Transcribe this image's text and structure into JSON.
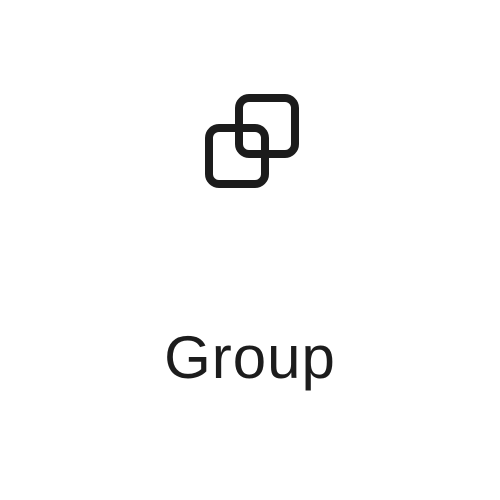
{
  "tool": {
    "label": "Group",
    "icon": "group-icon"
  },
  "colors": {
    "background": "#ffffff",
    "foreground": "#1c1c1c"
  }
}
